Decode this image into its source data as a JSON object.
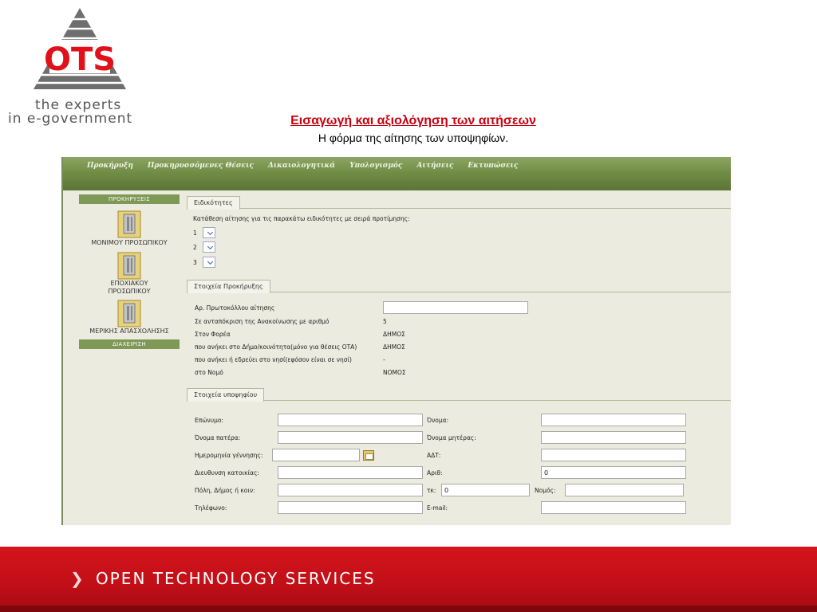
{
  "logo": {
    "brand": "OTS",
    "tagline_1": "the experts",
    "tagline_2": "in e-government"
  },
  "slide": {
    "title": "Εισαγωγή και αξιολόγηση των αιτήσεων",
    "subtitle": "Η φόρμα της αίτησης των υποψηφίων."
  },
  "menu": {
    "items": [
      "Προκήρυξη",
      "Προκηρυσσόμενες Θέσεις",
      "Δικαιολογητικά",
      "Υπολογισμός",
      "Αιτήσεις",
      "Εκτυπώσεις"
    ]
  },
  "sidebar": {
    "header": "ΠΡΟΚΗΡΥΞΕΙΣ",
    "items": [
      {
        "label": "ΜΟΝΙΜΟΥ ΠΡΟΣΩΠΙΚΟΥ",
        "icon": "folder-icon"
      },
      {
        "label": "ΕΠΟΧΙΑΚΟΥ ΠΡΟΣΩΠΙΚΟΥ",
        "icon": "folder-icon"
      },
      {
        "label": "ΜΕΡΙΚΗΣ ΑΠΑΣΧΟΛΗΣΗΣ",
        "icon": "folder-icon"
      }
    ],
    "footer": "ΔΙΑΧΕΙΡΙΣΗ"
  },
  "specialties": {
    "tab": "Ειδικότητες",
    "instruction": "Κατάθεση αίτησης για τις παρακάτω ειδικότητες με σειρά προτίμησης:",
    "choices": [
      "1",
      "2",
      "3"
    ]
  },
  "announcement": {
    "tab": "Στοιχεία Προκήρυξης",
    "rows": [
      {
        "label": "Αρ. Πρωτοκόλλου αίτησης",
        "value": ""
      },
      {
        "label": "Σε ανταπόκριση της Ανακοίνωσης με αριθμό",
        "value": "5"
      },
      {
        "label": "Στον Φορέα",
        "value": "ΔΗΜΟΣ"
      },
      {
        "label": "που ανήκει στο Δήμο/κοινότητα(μόνο για θέσεις ΟΤΑ)",
        "value": "ΔΗΜΟΣ"
      },
      {
        "label": "που ανήκει ή εδρεύει στο νησί(εφόσον είναι σε νησί)",
        "value": "-"
      },
      {
        "label": "στο Νομό",
        "value": "ΝΟΜΟΣ"
      }
    ]
  },
  "candidate": {
    "tab": "Στοιχεία υποψηφίου",
    "left": [
      {
        "label": "Επώνυμο:",
        "value": ""
      },
      {
        "label": "Όνομα πατέρα:",
        "value": ""
      },
      {
        "label": "Ημερομηνία γέννησης:",
        "value": ""
      },
      {
        "label": "Διευθυνση κατοικίας:",
        "value": ""
      },
      {
        "label": "Πόλη, Δήμος ή κοιν:",
        "value": ""
      },
      {
        "label": "Τηλέφωνο:",
        "value": ""
      }
    ],
    "right": [
      {
        "label": "Όνομα:",
        "value": ""
      },
      {
        "label": "Όνομα μητέρας:",
        "value": ""
      },
      {
        "label": "ΑΔΤ:",
        "value": ""
      },
      {
        "label": "Αριθ:",
        "value": "0"
      },
      {
        "label": "τκ:",
        "value": "0"
      },
      {
        "label": "E-mail:",
        "value": ""
      }
    ],
    "prefecture_label": "Νομός:"
  },
  "footer": {
    "text": "OPEN TECHNOLOGY SERVICES"
  },
  "colors": {
    "brand_red": "#c8000f",
    "menu_green": "#7a9550",
    "app_bg": "#ecebdf"
  }
}
